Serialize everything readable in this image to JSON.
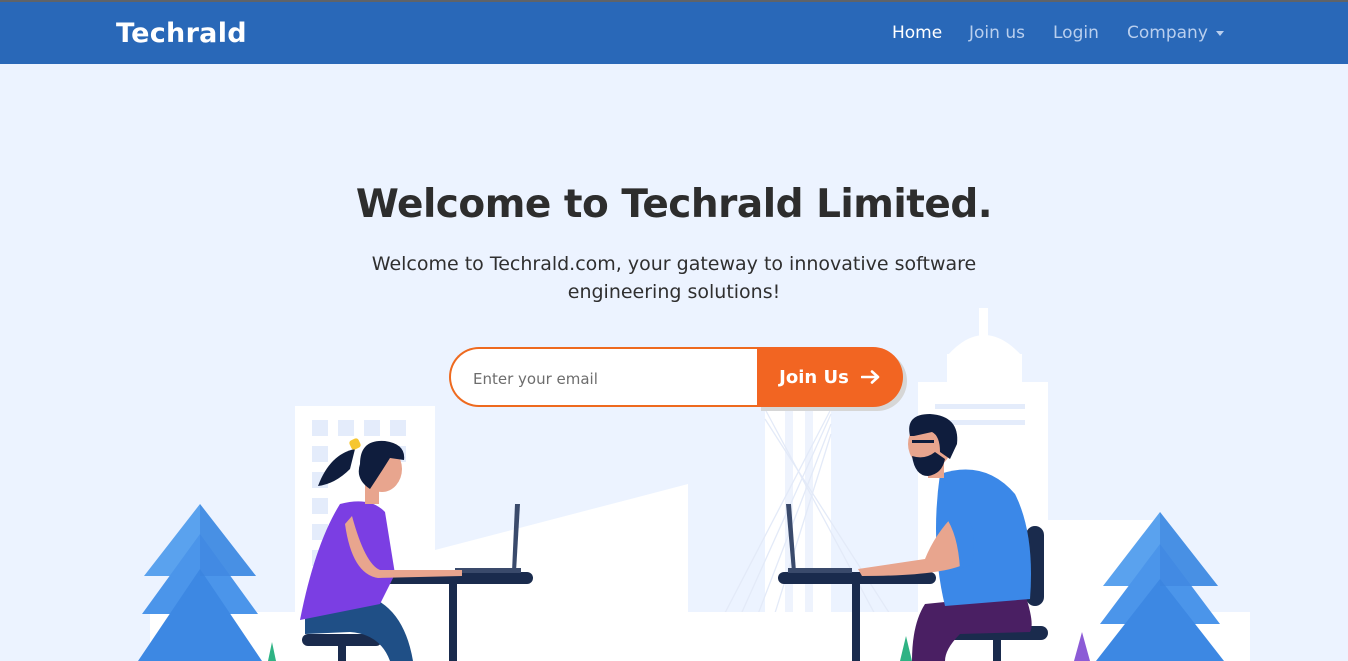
{
  "navbar": {
    "brand": "Techrald",
    "items": [
      {
        "label": "Home",
        "active": true
      },
      {
        "label": "Join us",
        "active": false
      },
      {
        "label": "Login",
        "active": false
      },
      {
        "label": "Company",
        "active": false
      }
    ]
  },
  "hero": {
    "title": "Welcome to Techrald Limited.",
    "subtitle": "Welcome to Techrald.com, your gateway to innovative software engineering solutions!",
    "email_placeholder": "Enter your email",
    "join_label": "Join Us"
  },
  "icons": {
    "dropdown": "chevron-down-icon",
    "join": "arrow-right-icon"
  },
  "colors": {
    "navbar": "#2968b8",
    "background": "#ecf3ff",
    "accent": "#f26522",
    "title": "#2d2d2d"
  }
}
